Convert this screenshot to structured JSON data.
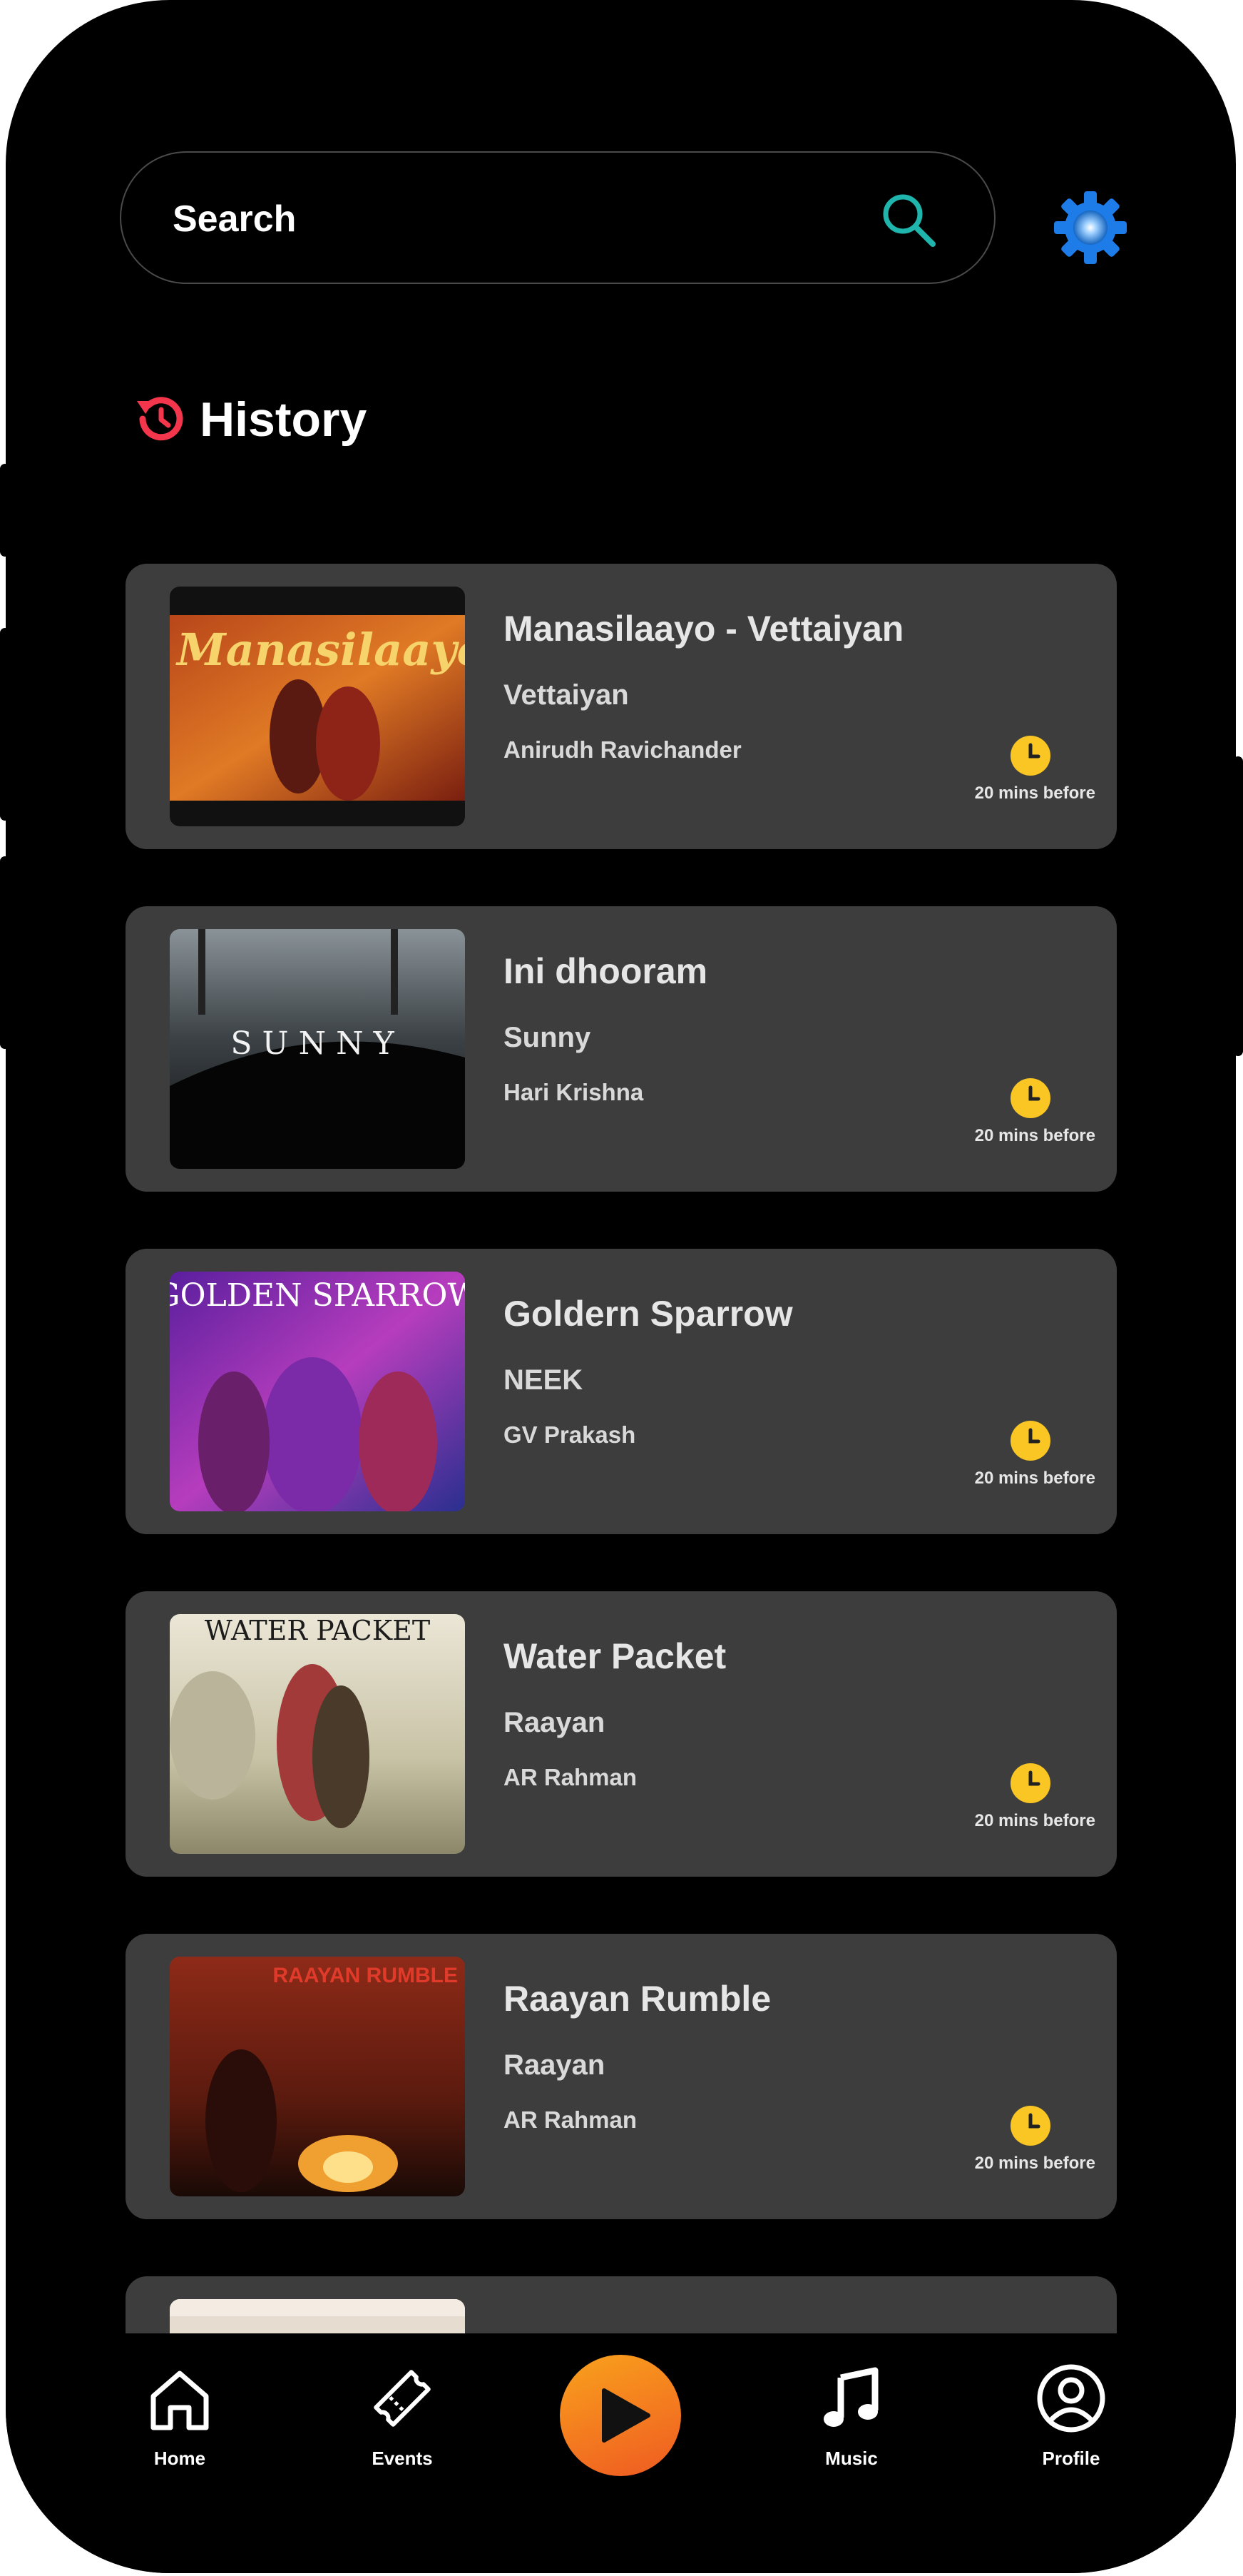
{
  "search": {
    "placeholder": "Search"
  },
  "section": {
    "title": "History"
  },
  "history": [
    {
      "title": "Manasilaayo - Vettaiyan",
      "album": "Vettaiyan",
      "artist": "Anirudh Ravichander",
      "time": "20 mins before",
      "cover_text": "Manasilaayo"
    },
    {
      "title": "Ini dhooram",
      "album": "Sunny",
      "artist": "Hari Krishna",
      "time": "20 mins before",
      "cover_text": "SUNNY"
    },
    {
      "title": "Goldern Sparrow",
      "album": "NEEK",
      "artist": "GV Prakash",
      "time": "20 mins before",
      "cover_text": "GOLDEN SPARROW"
    },
    {
      "title": "Water Packet",
      "album": "Raayan",
      "artist": "AR Rahman",
      "time": "20 mins before",
      "cover_text": "WATER PACKET"
    },
    {
      "title": "Raayan Rumble",
      "album": "Raayan",
      "artist": "AR Rahman",
      "time": "20 mins before",
      "cover_text": "RAAYAN RUMBLE"
    }
  ],
  "nav": {
    "home": "Home",
    "events": "Events",
    "music": "Music",
    "profile": "Profile"
  },
  "colors": {
    "accent_orange": "#F7931E",
    "clock_yellow": "#F9C623",
    "card_bg": "#3D3D3D",
    "gear_blue": "#1E88E5",
    "history_red": "#F4364C",
    "search_teal": "#1FB5AD"
  }
}
